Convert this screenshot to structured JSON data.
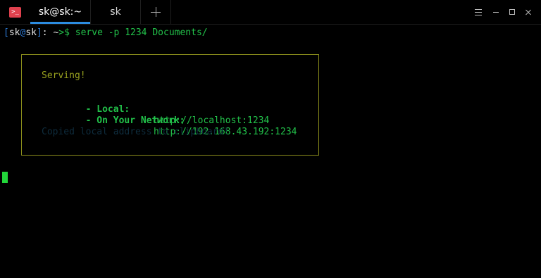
{
  "app": {
    "icon_label": ">_",
    "accent_color": "#2c8ce0"
  },
  "tabs": [
    {
      "label": "sk@sk:~",
      "active": true
    },
    {
      "label": "sk",
      "active": false
    }
  ],
  "window_controls": [
    "menu-icon",
    "minimize-icon",
    "maximize-icon",
    "close-icon"
  ],
  "terminal": {
    "prompt": {
      "open_bracket": "[",
      "user": "sk",
      "at": "@",
      "host": "sk",
      "close_bracket": "]",
      "colon": ":",
      "path": " ~",
      "symbol": ">$",
      "command": " serve -p 1234 Documents/"
    },
    "box": {
      "serving": "Serving!",
      "local_label": "- Local:",
      "local_value": "http://localhost:1234",
      "network_label": "- On Your Network:",
      "network_value": "http://192.168.43.192:1234",
      "copied": "Copied local address to clipboard!"
    }
  }
}
